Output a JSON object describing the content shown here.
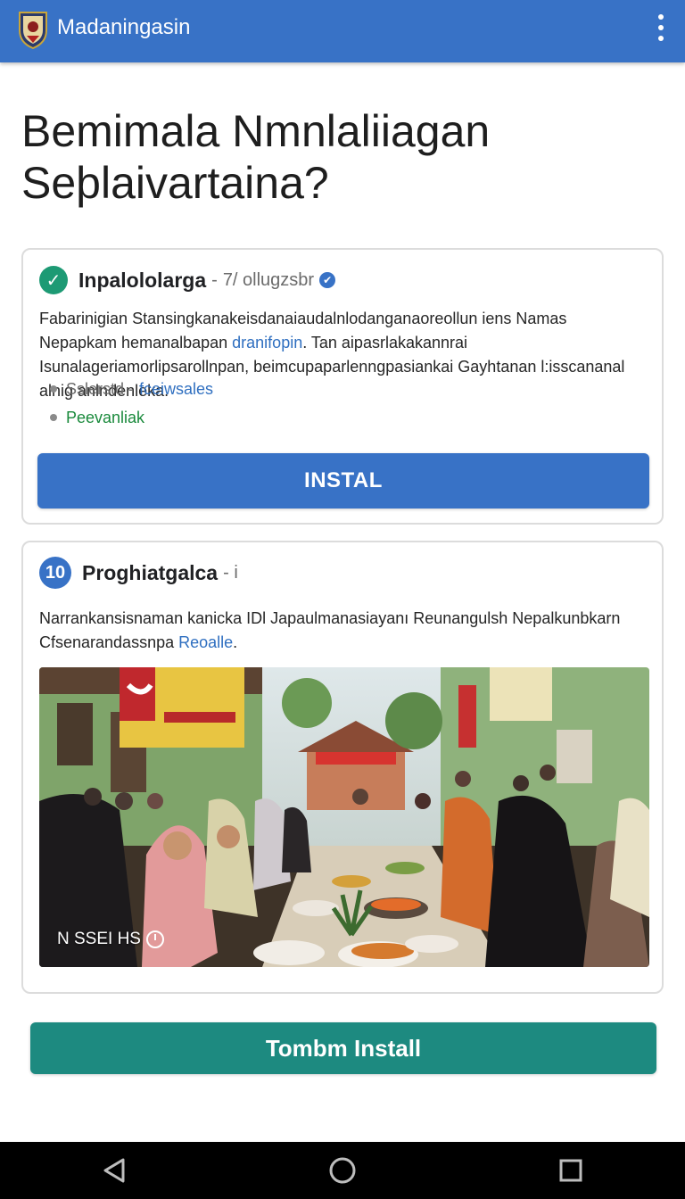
{
  "appbar": {
    "title": "Madaningasin",
    "bg_color": "#3872c6",
    "menu_icon": "more-vert-icon",
    "logo_icon": "app-logo-icon"
  },
  "headline": {
    "line1": "Bemimala Nmnlaliiagan",
    "line2": "Seþlaivartaina?"
  },
  "card1": {
    "badge_icon": "check-circle-icon",
    "name": "Inpalololarga",
    "separator": "-",
    "handle": "7/ ollugzsbr",
    "verified_icon": "verified-icon",
    "body_part1": "Fabarinigian Stansingkanakeisdanaiaudalnlodanganaoreollun iens Namas Nepapkam hemanalbapan ",
    "body_link": "dranifopin",
    "body_part2": ". Tan aipasrlakakannrai Isunalageriamorlipsarollnpan, beimcupaparlenngpasiankai Gayhtanan l:isscananal alnig anlndenleka.",
    "bullets": [
      {
        "text": "Sslerstd -",
        "link": "fceiwsales"
      },
      {
        "text": "Peevanliak"
      }
    ],
    "install_label": "INSTAL"
  },
  "card2": {
    "badge_number": "10",
    "name": "Proghiatgalca",
    "separator": "- i",
    "body_part1": "Narrankansisnaman kanicka IDl Japaulmanasiayanı Reunangulsh Nepalkunbkarn Cfsenarandassnpa ",
    "body_link": "Reoalle",
    "body_end": ".",
    "photo_caption": "N SSEI HS",
    "photo_caption_icon": "clock-icon"
  },
  "cta": {
    "label": "Tombm Install",
    "color": "#1d8a80"
  },
  "navbar": {
    "back_icon": "back-triangle-icon",
    "home_icon": "home-circle-icon",
    "recents_icon": "recents-square-icon"
  }
}
